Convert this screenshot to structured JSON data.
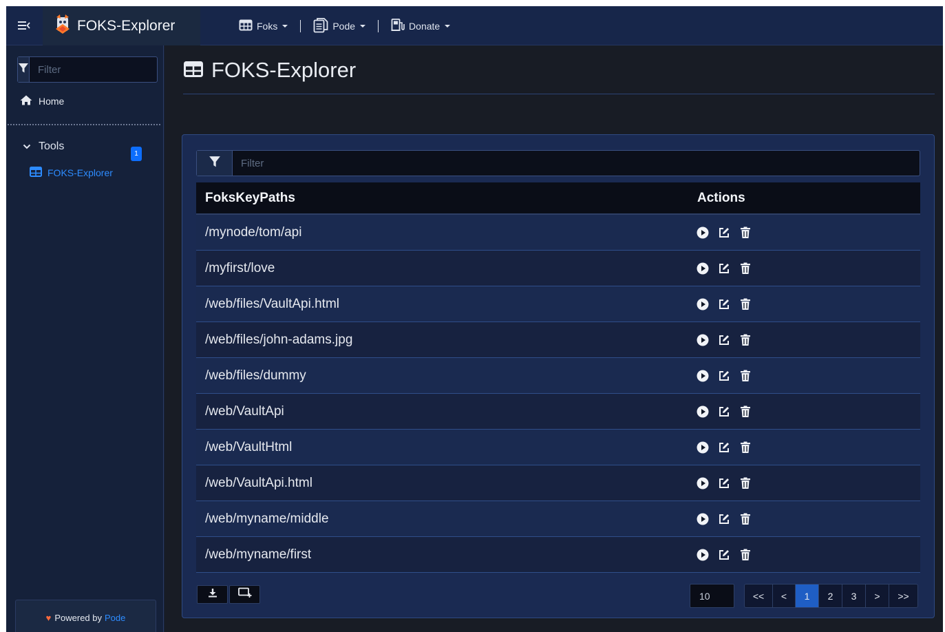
{
  "app": {
    "brand_title": "FOKS-Explorer"
  },
  "nav": {
    "items": [
      {
        "label": "Foks",
        "icon": "table-icon"
      },
      {
        "label": "Pode",
        "icon": "document-icon"
      },
      {
        "label": "Donate",
        "icon": "donate-icon"
      }
    ]
  },
  "sidebar": {
    "filter_placeholder": "Filter",
    "home_label": "Home",
    "tools_label": "Tools",
    "tools_badge": "1",
    "active_item_label": "FOKS-Explorer",
    "footer_powered": "Powered by",
    "footer_link": "Pode"
  },
  "main": {
    "page_title": "FOKS-Explorer",
    "table": {
      "filter_placeholder": "Filter",
      "headers": [
        "FoksKeyPaths",
        "Actions"
      ],
      "rows": [
        "/mynode/tom/api",
        "/myfirst/love",
        "/web/files/VaultApi.html",
        "/web/files/john-adams.jpg",
        "/web/files/dummy",
        "/web/VaultApi",
        "/web/VaultHtml",
        "/web/VaultApi.html",
        "/web/myname/middle",
        "/web/myname/first"
      ],
      "row_actions": [
        "play-icon",
        "edit-icon",
        "trash-icon"
      ]
    },
    "pagination": {
      "page_size": "10",
      "controls": [
        "<<",
        "<",
        "1",
        "2",
        "3",
        ">",
        ">>"
      ],
      "active_page": "1"
    }
  },
  "colors": {
    "accent": "#0d6efd",
    "link": "#2d8cff",
    "heart": "#ff6a3d",
    "active_page": "#1f5ec4"
  }
}
